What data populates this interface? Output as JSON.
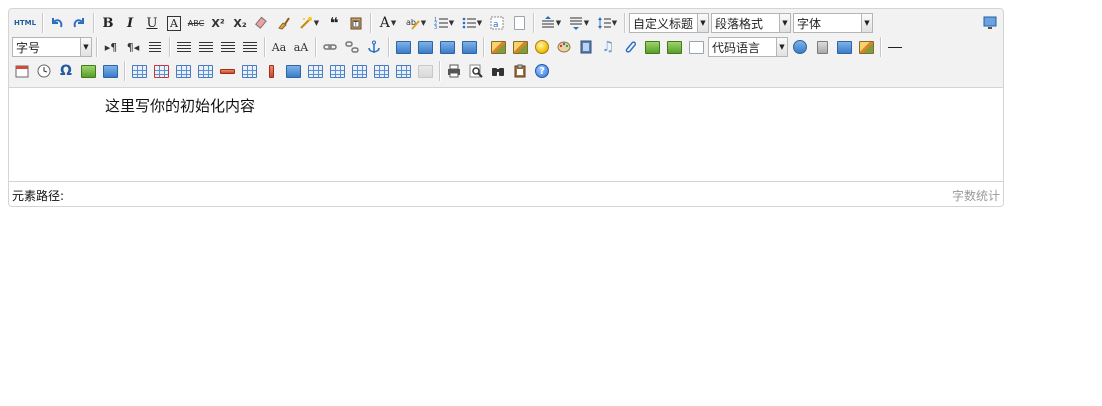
{
  "toolbar": {
    "html_label": "HTML",
    "selects": {
      "custom_heading": "自定义标题",
      "paragraph_format": "段落格式",
      "font_family": "字体",
      "font_size": "字号",
      "code_language": "代码语言"
    }
  },
  "editor": {
    "content_text": "这里写你的初始化内容"
  },
  "statusbar": {
    "path_label": "元素路径:",
    "word_count_label": "字数统计"
  },
  "icons": {
    "help": "?",
    "omega": "Ω",
    "quote": "❝",
    "bold": "B",
    "italic": "I",
    "underline": "U",
    "font_border": "A",
    "strike": "ABC",
    "superscript": "X²",
    "subscript": "X₂",
    "fore_color": "A"
  }
}
